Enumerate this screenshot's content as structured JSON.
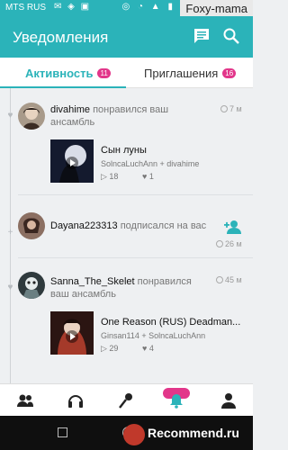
{
  "status_bar": {
    "carrier": "MTS RUS",
    "left_icons": "✉ ◈ ▣",
    "right_icons": "◎ ◔ ▲ ▮"
  },
  "watermark": "Foxy-mama",
  "app_bar": {
    "title": "Уведомления"
  },
  "tabs": [
    {
      "label": "Активность",
      "badge": "11"
    },
    {
      "label": "Приглашения",
      "badge": "16"
    }
  ],
  "feed": [
    {
      "user": "divahime",
      "action": "понравился ваш ансамбль",
      "time": "7 м",
      "card": {
        "title": "Сын луны",
        "subtitle": "SolncaLuchAnn + divahime",
        "plays": "18",
        "likes": "1"
      }
    },
    {
      "user": "Dayana223313",
      "action": "подписался на вас",
      "time": "26 м"
    },
    {
      "user": "Sanna_The_Skelet",
      "action": "понравился ваш ансамбль",
      "time": "45 м",
      "card": {
        "title": "One Reason (RUS) Deadman...",
        "subtitle": "Ginsan114 + SolncaLuchAnn",
        "plays": "29",
        "likes": "4"
      }
    }
  ],
  "bottom_nav": [
    "people-icon",
    "headphones-icon",
    "microphone-icon",
    "notifications-icon",
    "profile-icon"
  ],
  "recommend_watermark": "Recommend.ru",
  "colors": {
    "primary": "#2bb3b9",
    "badge": "#e2368a"
  }
}
